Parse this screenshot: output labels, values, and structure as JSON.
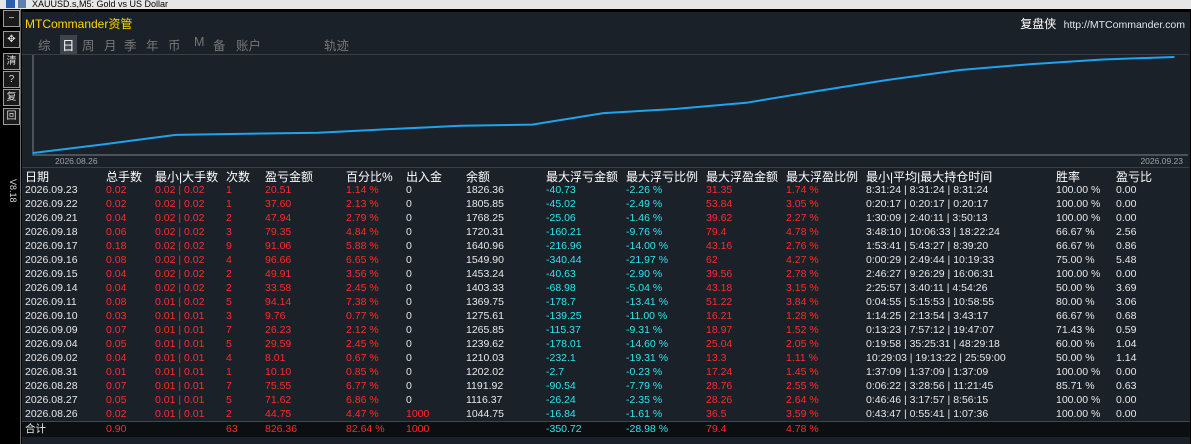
{
  "window": {
    "title": "XAUUSD.s,M5:  Gold vs US Dollar"
  },
  "toolstrip": {
    "buttons": [
      "−",
      "✥",
      "清",
      "?",
      "复",
      "回"
    ],
    "version": "V8.18"
  },
  "brand": {
    "name": "MTCommander资管",
    "right_name": "复盘侠",
    "site": "http://MTCommander.com"
  },
  "tabs": [
    "综",
    "日",
    "周",
    "月",
    "季",
    "年",
    "币",
    "M",
    "备",
    "账户",
    "轨迹"
  ],
  "active_tab": "日",
  "chart_data": {
    "type": "line",
    "x": [
      "2026.08.26",
      "2026.08.27",
      "2026.08.28",
      "2026.08.31",
      "2026.09.02",
      "2026.09.04",
      "2026.09.09",
      "2026.09.10",
      "2026.09.11",
      "2026.09.14",
      "2026.09.15",
      "2026.09.16",
      "2026.09.17",
      "2026.09.18",
      "2026.09.21",
      "2026.09.22",
      "2026.09.23"
    ],
    "y": [
      1044.75,
      1116.37,
      1191.92,
      1202.02,
      1210.03,
      1239.62,
      1265.85,
      1275.61,
      1369.75,
      1403.33,
      1453.24,
      1549.9,
      1640.96,
      1720.31,
      1768.25,
      1805.85,
      1826.36
    ],
    "start_label": "2026.08.26",
    "end_label": "2026.09.23",
    "color": "#1fa3ef"
  },
  "table": {
    "headers": [
      "日期",
      "总手数",
      "最小|大手数",
      "次数",
      "盈亏金额",
      "百分比%",
      "出入金",
      "余额",
      "最大浮亏金额",
      "最大浮亏比例",
      "最大浮盈金额",
      "最大浮盈比例",
      "最小|平均|最大持仓时间",
      "胜率",
      "盈亏比"
    ],
    "rows": [
      [
        "2026.09.23",
        "0.02",
        "0.02 | 0.02",
        "1",
        "20.51",
        "1.14 %",
        "0",
        "1826.36",
        "-40.73",
        "-2.26 %",
        "31.35",
        "1.74 %",
        "8:31:24 | 8:31:24 | 8:31:24",
        "100.00 %",
        "0.00"
      ],
      [
        "2026.09.22",
        "0.02",
        "0.02 | 0.02",
        "1",
        "37.60",
        "2.13 %",
        "0",
        "1805.85",
        "-45.02",
        "-2.49 %",
        "53.84",
        "3.05 %",
        "0:20:17 | 0:20:17 | 0:20:17",
        "100.00 %",
        "0.00"
      ],
      [
        "2026.09.21",
        "0.04",
        "0.02 | 0.02",
        "2",
        "47.94",
        "2.79 %",
        "0",
        "1768.25",
        "-25.06",
        "-1.46 %",
        "39.62",
        "2.27 %",
        "1:30:09 | 2:40:11 | 3:50:13",
        "100.00 %",
        "0.00"
      ],
      [
        "2026.09.18",
        "0.06",
        "0.02 | 0.02",
        "3",
        "79.35",
        "4.84 %",
        "0",
        "1720.31",
        "-160.21",
        "-9.76 %",
        "79.4",
        "4.78 %",
        "3:48:10 | 10:06:33 | 18:22:24",
        "66.67 %",
        "2.56"
      ],
      [
        "2026.09.17",
        "0.18",
        "0.02 | 0.02",
        "9",
        "91.06",
        "5.88 %",
        "0",
        "1640.96",
        "-216.96",
        "-14.00 %",
        "43.16",
        "2.76 %",
        "1:53:41 | 5:43:27 | 8:39:20",
        "66.67 %",
        "0.86"
      ],
      [
        "2026.09.16",
        "0.08",
        "0.02 | 0.02",
        "4",
        "96.66",
        "6.65 %",
        "0",
        "1549.90",
        "-340.44",
        "-21.97 %",
        "62",
        "4.27 %",
        "0:00:29 | 2:49:44 | 10:19:33",
        "75.00 %",
        "5.48"
      ],
      [
        "2026.09.15",
        "0.04",
        "0.02 | 0.02",
        "2",
        "49.91",
        "3.56 %",
        "0",
        "1453.24",
        "-40.63",
        "-2.90 %",
        "39.56",
        "2.78 %",
        "2:46:27 | 9:26:29 | 16:06:31",
        "100.00 %",
        "0.00"
      ],
      [
        "2026.09.14",
        "0.04",
        "0.02 | 0.02",
        "2",
        "33.58",
        "2.45 %",
        "0",
        "1403.33",
        "-68.98",
        "-5.04 %",
        "43.18",
        "3.15 %",
        "2:25:57 | 3:40:11 | 4:54:26",
        "50.00 %",
        "3.69"
      ],
      [
        "2026.09.11",
        "0.08",
        "0.01 | 0.02",
        "5",
        "94.14",
        "7.38 %",
        "0",
        "1369.75",
        "-178.7",
        "-13.41 %",
        "51.22",
        "3.84 %",
        "0:04:55 | 5:15:53 | 10:58:55",
        "80.00 %",
        "3.06"
      ],
      [
        "2026.09.10",
        "0.03",
        "0.01 | 0.01",
        "3",
        "9.76",
        "0.77 %",
        "0",
        "1275.61",
        "-139.25",
        "-11.00 %",
        "16.21",
        "1.28 %",
        "1:14:25 | 2:13:54 | 3:43:17",
        "66.67 %",
        "0.68"
      ],
      [
        "2026.09.09",
        "0.07",
        "0.01 | 0.01",
        "7",
        "26.23",
        "2.12 %",
        "0",
        "1265.85",
        "-115.37",
        "-9.31 %",
        "18.97",
        "1.52 %",
        "0:13:23 | 7:57:12 | 19:47:07",
        "71.43 %",
        "0.59"
      ],
      [
        "2026.09.04",
        "0.05",
        "0.01 | 0.01",
        "5",
        "29.59",
        "2.45 %",
        "0",
        "1239.62",
        "-178.01",
        "-14.60 %",
        "25.04",
        "2.05 %",
        "0:19:58 | 35:25:31 | 48:29:18",
        "60.00 %",
        "1.04"
      ],
      [
        "2026.09.02",
        "0.04",
        "0.01 | 0.01",
        "4",
        "8.01",
        "0.67 %",
        "0",
        "1210.03",
        "-232.1",
        "-19.31 %",
        "13.3",
        "1.11 %",
        "10:29:03 | 19:13:22 | 25:59:00",
        "50.00 %",
        "1.14"
      ],
      [
        "2026.08.31",
        "0.01",
        "0.01 | 0.01",
        "1",
        "10.10",
        "0.85 %",
        "0",
        "1202.02",
        "-2.7",
        "-0.23 %",
        "17.24",
        "1.45 %",
        "1:37:09 | 1:37:09 | 1:37:09",
        "100.00 %",
        "0.00"
      ],
      [
        "2026.08.28",
        "0.07",
        "0.01 | 0.01",
        "7",
        "75.55",
        "6.77 %",
        "0",
        "1191.92",
        "-90.54",
        "-7.79 %",
        "28.76",
        "2.55 %",
        "0:06:22 | 3:28:56 | 11:21:45",
        "85.71 %",
        "0.63"
      ],
      [
        "2026.08.27",
        "0.05",
        "0.01 | 0.01",
        "5",
        "71.62",
        "6.86 %",
        "0",
        "1116.37",
        "-26.24",
        "-2.35 %",
        "28.26",
        "2.64 %",
        "0:46:46 | 3:17:57 | 8:56:15",
        "100.00 %",
        "0.00"
      ],
      [
        "2026.08.26",
        "0.02",
        "0.01 | 0.01",
        "2",
        "44.75",
        "4.47 %",
        "1000",
        "1044.75",
        "-16.84",
        "-1.61 %",
        "36.5",
        "3.59 %",
        "0:43:47 | 0:55:41 | 1:07:36",
        "100.00 %",
        "0.00"
      ]
    ],
    "total": [
      "合计",
      "0.90",
      "",
      "63",
      "826.36",
      "82.64 %",
      "1000",
      "",
      "-350.72",
      "-28.98 %",
      "79.4",
      "4.78 %",
      "",
      "",
      ""
    ]
  },
  "colors": {
    "white": "#e8e8e8",
    "red": "#ff2b2b",
    "cyan": "#2ee6f0",
    "gold": "#ffd700",
    "line": "#1fa3ef"
  }
}
